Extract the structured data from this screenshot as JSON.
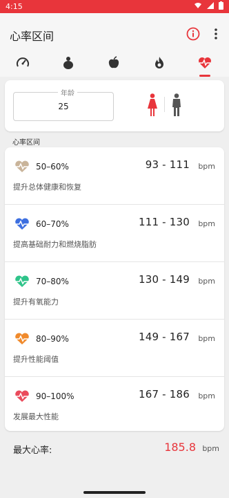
{
  "status_bar": {
    "time": "4:15"
  },
  "app_bar": {
    "title": "心率区间"
  },
  "tabs": [
    {
      "icon": "speedometer-icon"
    },
    {
      "icon": "body-weight-icon"
    },
    {
      "icon": "apple-icon"
    },
    {
      "icon": "flame-icon"
    },
    {
      "icon": "heart-rate-icon",
      "active": true
    }
  ],
  "age": {
    "label": "年龄",
    "value": "25"
  },
  "section_label": "心率区间",
  "zones": [
    {
      "percent": "50–60%",
      "range": "93 - 111",
      "unit": "bpm",
      "desc": "提升总体健康和恢复",
      "color": "#c9b49a"
    },
    {
      "percent": "60–70%",
      "range": "111 - 130",
      "unit": "bpm",
      "desc": "提高基础耐力和燃烧脂肪",
      "color": "#3d6fe0"
    },
    {
      "percent": "70–80%",
      "range": "130 - 149",
      "unit": "bpm",
      "desc": "提升有氧能力",
      "color": "#2fc48a"
    },
    {
      "percent": "80–90%",
      "range": "149 - 167",
      "unit": "bpm",
      "desc": "提升性能阈值",
      "color": "#f08a2c"
    },
    {
      "percent": "90–100%",
      "range": "167 - 186",
      "unit": "bpm",
      "desc": "发展最大性能",
      "color": "#ea4b5c"
    }
  ],
  "max_hr": {
    "label": "最大心率:",
    "value": "185.8",
    "unit": "bpm"
  },
  "colors": {
    "accent": "#e8353b",
    "male": "#555555"
  }
}
